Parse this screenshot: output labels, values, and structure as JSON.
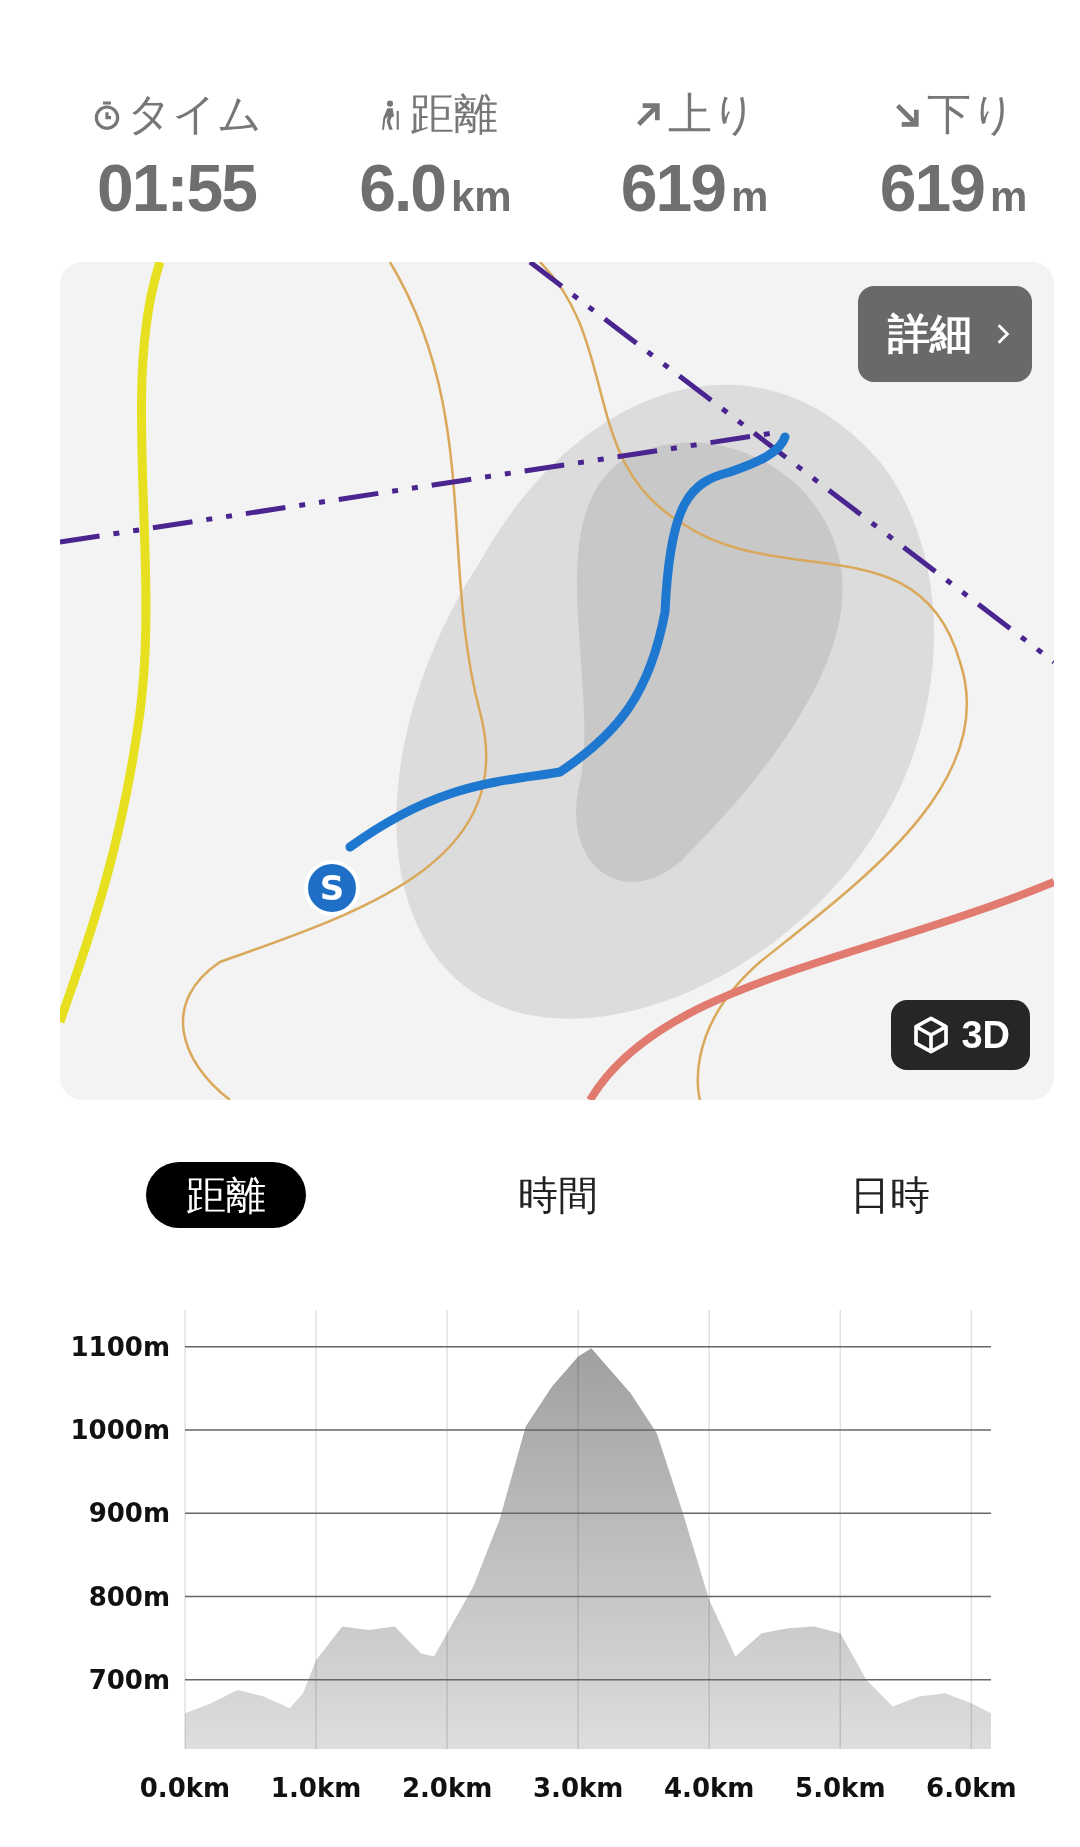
{
  "stats": [
    {
      "kind": "time",
      "label": "タイム",
      "value": "01:55"
    },
    {
      "kind": "distance",
      "label": "距離",
      "value": "6.0",
      "unit": "km"
    },
    {
      "kind": "ascent",
      "label": "上り",
      "value": "619",
      "unit": "m"
    },
    {
      "kind": "descent",
      "label": "下り",
      "value": "619",
      "unit": "m"
    }
  ],
  "map": {
    "details_button": "詳細",
    "view_3d_button": "3D",
    "start_marker": "S"
  },
  "tabs": [
    {
      "label": "距離",
      "selected": true
    },
    {
      "label": "時間",
      "selected": false
    },
    {
      "label": "日時",
      "selected": false
    }
  ],
  "elevation": {
    "chart_data": {
      "type": "area",
      "x": [
        0,
        0.2,
        0.4,
        0.6,
        0.8,
        0.9,
        1.0,
        1.2,
        1.4,
        1.6,
        1.8,
        1.9,
        2.0,
        2.2,
        2.4,
        2.6,
        2.8,
        3.0,
        3.1,
        3.2,
        3.4,
        3.6,
        3.8,
        4.0,
        4.2,
        4.4,
        4.6,
        4.8,
        5.0,
        5.2,
        5.4,
        5.6,
        5.8,
        6.0,
        6.15
      ],
      "grid": true,
      "series": [
        {
          "color": "#a0a0a0",
          "values": [
            660,
            672,
            688,
            680,
            666,
            684,
            724,
            764,
            760,
            764,
            732,
            728,
            756,
            812,
            892,
            1004,
            1052,
            1088,
            1098,
            1080,
            1044,
            996,
            900,
            796,
            728,
            756,
            762,
            764,
            756,
            700,
            668,
            680,
            684,
            672,
            660
          ]
        }
      ],
      "xlim": [
        0,
        6.15
      ],
      "ylim": [
        617,
        1144
      ],
      "xticks": [
        {
          "value": 0,
          "label": "0.0km"
        },
        {
          "value": 1,
          "label": "1.0km"
        },
        {
          "value": 2,
          "label": "2.0km"
        },
        {
          "value": 3,
          "label": "3.0km"
        },
        {
          "value": 4,
          "label": "4.0km"
        },
        {
          "value": 5,
          "label": "5.0km"
        },
        {
          "value": 6,
          "label": "6.0km"
        }
      ],
      "yticks": [
        {
          "value": 700,
          "label": "700m"
        },
        {
          "value": 800,
          "label": "800m"
        },
        {
          "value": 900,
          "label": "900m"
        },
        {
          "value": 1000,
          "label": "1000m"
        },
        {
          "value": 1100,
          "label": "1100m"
        }
      ]
    }
  }
}
